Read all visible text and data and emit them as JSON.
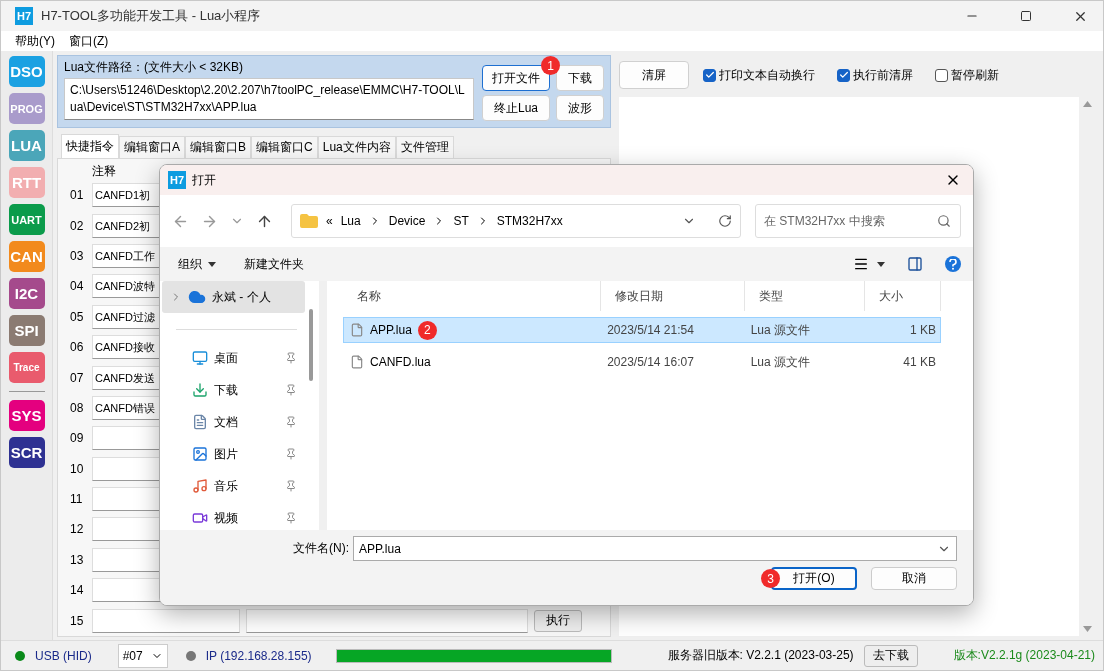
{
  "window": {
    "title": "H7-TOOL多功能开发工具 - Lua小程序",
    "logo": "H7"
  },
  "menu": [
    {
      "label": "帮助(Y)"
    },
    {
      "label": "窗口(Z)"
    }
  ],
  "sidebar": [
    {
      "label": "DSO",
      "color": "#1ba1e2"
    },
    {
      "label": "PROG",
      "color": "#a99bcb"
    },
    {
      "label": "LUA",
      "color": "#4ba6b9"
    },
    {
      "label": "RTT",
      "color": "#f2aeb0"
    },
    {
      "label": "UART",
      "color": "#0b9b4b"
    },
    {
      "label": "CAN",
      "color": "#f28a1d"
    },
    {
      "label": "I2C",
      "color": "#a54a8c"
    },
    {
      "label": "SPI",
      "color": "#8b7b72"
    },
    {
      "label": "Trace",
      "color": "#e95b6d"
    },
    {
      "label": "SYS",
      "color": "#e4007f",
      "divider_before": true
    },
    {
      "label": "SCR",
      "color": "#2e3192"
    }
  ],
  "path_panel": {
    "label": "Lua文件路径：(文件大小 < 32KB)",
    "value": "C:\\Users\\51246\\Desktop\\2.20\\2.207\\h7toolPC_release\\EMMC\\H7-TOOL\\Lua\\Device\\ST\\STM32H7xx\\APP.lua",
    "buttons": [
      {
        "label": "打开文件",
        "focused": true,
        "badge": "1"
      },
      {
        "label": "下载",
        "focused": false
      },
      {
        "label": "终止Lua",
        "focused": false
      },
      {
        "label": "波形",
        "focused": false
      }
    ]
  },
  "tabs": [
    {
      "label": "快捷指令",
      "selected": true
    },
    {
      "label": "编辑窗口A",
      "selected": false
    },
    {
      "label": "编辑窗口B",
      "selected": false
    },
    {
      "label": "编辑窗口C",
      "selected": false
    },
    {
      "label": "Lua文件内容",
      "selected": false
    },
    {
      "label": "文件管理",
      "selected": false
    }
  ],
  "quick_commands": {
    "column": "注释",
    "rows": [
      {
        "number": "01",
        "comment": "CANFD1初"
      },
      {
        "number": "02",
        "comment": "CANFD2初"
      },
      {
        "number": "03",
        "comment": "CANFD工作"
      },
      {
        "number": "04",
        "comment": "CANFD波特"
      },
      {
        "number": "05",
        "comment": "CANFD过滤"
      },
      {
        "number": "06",
        "comment": "CANFD接收"
      },
      {
        "number": "07",
        "comment": "CANFD发送"
      },
      {
        "number": "08",
        "comment": "CANFD错误"
      },
      {
        "number": "09"
      },
      {
        "number": "10"
      },
      {
        "number": "11"
      },
      {
        "number": "12"
      },
      {
        "number": "13"
      },
      {
        "number": "14"
      },
      {
        "number": "15",
        "action": "执行"
      }
    ]
  },
  "output_panel": {
    "clear_button": "清屏",
    "checkboxes": [
      {
        "label": "打印文本自动换行",
        "checked": true
      },
      {
        "label": "执行前清屏",
        "checked": true
      },
      {
        "label": "暂停刷新",
        "checked": false
      }
    ]
  },
  "dialog": {
    "logo": "H7",
    "title": "打开",
    "overflow": "«",
    "breadcrumb": [
      "Lua",
      "Device",
      "ST",
      "STM32H7xx"
    ],
    "search": {
      "placeholder": "在 STM32H7xx 中搜索"
    },
    "organize": "组织",
    "new_folder": "新建文件夹",
    "nav": [
      {
        "label": "永斌 - 个人",
        "kind": "cloud",
        "selected": true,
        "pinned": false
      },
      {
        "label": "桌面",
        "kind": "desktop",
        "selected": false,
        "pinned": true
      },
      {
        "label": "下载",
        "kind": "download",
        "selected": false,
        "pinned": true
      },
      {
        "label": "文档",
        "kind": "document",
        "selected": false,
        "pinned": true
      },
      {
        "label": "图片",
        "kind": "picture",
        "selected": false,
        "pinned": true
      },
      {
        "label": "音乐",
        "kind": "music",
        "selected": false,
        "pinned": true
      },
      {
        "label": "视频",
        "kind": "video",
        "selected": false,
        "pinned": true
      }
    ],
    "columns": [
      "名称",
      "修改日期",
      "类型",
      "大小"
    ],
    "files": [
      {
        "name": "APP.lua",
        "modified": "2023/5/14 21:54",
        "type": "Lua 源文件",
        "size": "1 KB",
        "selected": true,
        "badge": "2"
      },
      {
        "name": "CANFD.lua",
        "modified": "2023/5/14 16:07",
        "type": "Lua 源文件",
        "size": "41 KB",
        "selected": false
      }
    ],
    "filename_label": "文件名(N):",
    "filename": "APP.lua",
    "buttons": [
      {
        "label": "打开(O)",
        "primary": true,
        "badge": "3"
      },
      {
        "label": "取消",
        "primary": false
      }
    ]
  },
  "status_bar": {
    "usb": {
      "label": "USB (HID)",
      "connected": true
    },
    "port": "#07",
    "ip": {
      "label": "IP (192.168.28.155)",
      "connected": false
    },
    "progress": {
      "level": 1
    },
    "server_version": "服务器旧版本: V2.2.1 (2023-03-25)",
    "download_button": "去下载",
    "version": "版本:V2.2.1g (2023-04-21)"
  }
}
